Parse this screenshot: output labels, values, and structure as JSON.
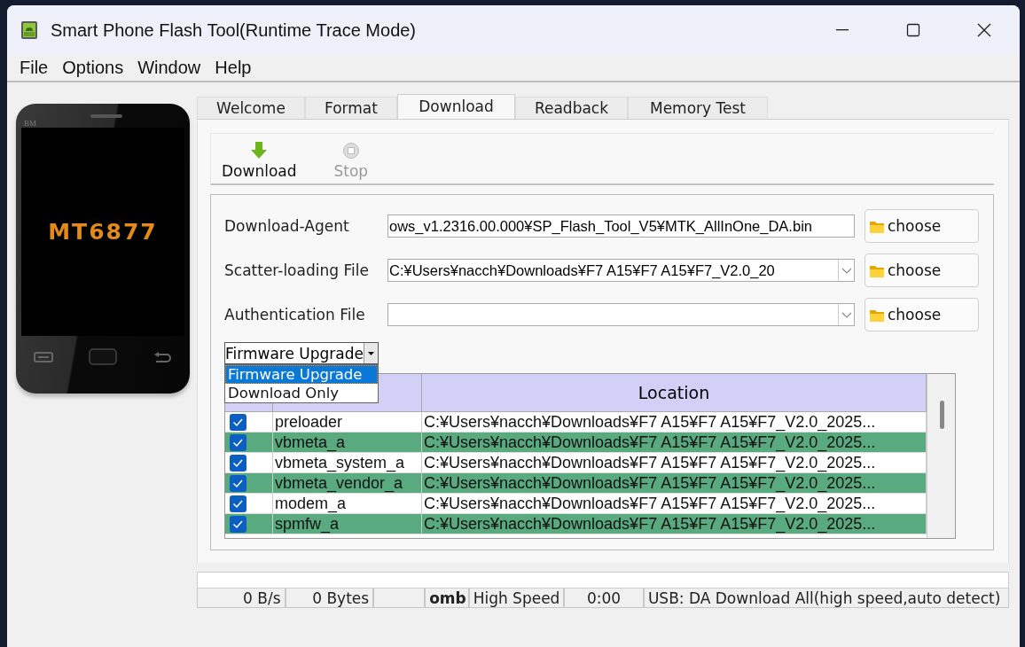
{
  "window": {
    "title": "Smart Phone Flash Tool(Runtime Trace Mode)"
  },
  "menu": [
    "File",
    "Options",
    "Window",
    "Help"
  ],
  "phone": {
    "brand": "BM",
    "chip": "MT6877"
  },
  "tabs": [
    {
      "label": "Welcome",
      "selected": false
    },
    {
      "label": "Format",
      "selected": false
    },
    {
      "label": "Download",
      "selected": true
    },
    {
      "label": "Readback",
      "selected": false
    },
    {
      "label": "Memory Test",
      "selected": false
    }
  ],
  "toolbar": [
    {
      "kind": "download",
      "label": "Download",
      "disabled": false
    },
    {
      "kind": "stop",
      "label": "Stop",
      "disabled": true
    }
  ],
  "files": [
    {
      "label": "Download-Agent",
      "kind": "text",
      "value": "ows_v1.2316.00.000¥SP_Flash_Tool_V5¥MTK_AllInOne_DA.bin",
      "button": "choose"
    },
    {
      "label": "Scatter-loading File",
      "kind": "combo",
      "value": "C:¥Users¥nacch¥Downloads¥F7 A15¥F7 A15¥F7_V2.0_20",
      "button": "choose"
    },
    {
      "label": "Authentication File",
      "kind": "combo",
      "button": "choose"
    }
  ],
  "mode": {
    "value": "Firmware Upgrade",
    "expanded": true,
    "options": [
      {
        "label": "Firmware Upgrade",
        "selected": true
      },
      {
        "label": "Download Only",
        "selected": false
      }
    ]
  },
  "table": {
    "columns": [
      "Location"
    ],
    "rows": [
      {
        "checked": true,
        "name": "preloader",
        "location": "C:¥Users¥nacch¥Downloads¥F7 A15¥F7 A15¥F7_V2.0_2025...",
        "selected": false
      },
      {
        "checked": true,
        "name": "vbmeta_a",
        "location": "C:¥Users¥nacch¥Downloads¥F7 A15¥F7 A15¥F7_V2.0_2025...",
        "selected": true
      },
      {
        "checked": true,
        "name": "vbmeta_system_a",
        "location": "C:¥Users¥nacch¥Downloads¥F7 A15¥F7 A15¥F7_V2.0_2025...",
        "selected": false
      },
      {
        "checked": true,
        "name": "vbmeta_vendor_a",
        "location": "C:¥Users¥nacch¥Downloads¥F7 A15¥F7 A15¥F7_V2.0_2025...",
        "selected": true
      },
      {
        "checked": true,
        "name": "modem_a",
        "location": "C:¥Users¥nacch¥Downloads¥F7 A15¥F7 A15¥F7_V2.0_2025...",
        "selected": false
      },
      {
        "checked": true,
        "name": "spmfw_a",
        "location": "C:¥Users¥nacch¥Downloads¥F7 A15¥F7 A15¥F7_V2.0_2025...",
        "selected": true
      }
    ]
  },
  "status_bar": {
    "level": 0,
    "cells": [
      {
        "text": "0 B/s",
        "kind": "right"
      },
      {
        "text": "0 Bytes",
        "kind": "right"
      },
      {
        "kind": "empty"
      },
      {
        "text": "omb",
        "kind": "bold"
      },
      {
        "text": "High Speed",
        "kind": "center"
      },
      {
        "text": "0:00",
        "kind": "center"
      },
      {
        "text": "USB: DA Download All(high speed,auto detect)",
        "kind": "left"
      }
    ]
  }
}
